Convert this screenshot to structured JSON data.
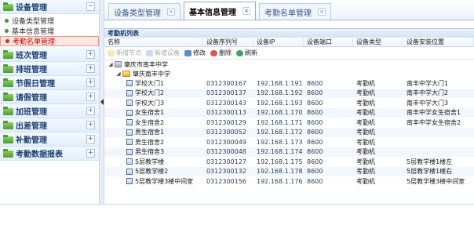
{
  "sidebar": {
    "menus": [
      {
        "title": "设备管理",
        "toggle": "−",
        "items": [
          {
            "label": "设备类型管理",
            "active": false
          },
          {
            "label": "基本信息管理",
            "active": false
          },
          {
            "label": "考勤名单管理",
            "active": true
          }
        ]
      },
      {
        "title": "班次管理",
        "toggle": "+"
      },
      {
        "title": "排班管理",
        "toggle": "+"
      },
      {
        "title": "节假日管理",
        "toggle": "+"
      },
      {
        "title": "请假管理",
        "toggle": "+"
      },
      {
        "title": "加班管理",
        "toggle": "+"
      },
      {
        "title": "出差管理",
        "toggle": "+"
      },
      {
        "title": "补勤管理",
        "toggle": "+"
      },
      {
        "title": "考勤数据报表",
        "toggle": "+"
      }
    ]
  },
  "tabs": [
    {
      "label": "设备类型管理",
      "close": "×",
      "active": false
    },
    {
      "label": "基本信息管理",
      "close": "×",
      "active": true
    },
    {
      "label": "考勤名单管理",
      "close": "×",
      "active": false
    }
  ],
  "panel": {
    "title": "考勤机列表",
    "columns": [
      "名称",
      "设备序列号",
      "设备IP",
      "设备端口",
      "设备类型",
      "设备安装位置"
    ]
  },
  "toolbar": {
    "add_label": "新增节点",
    "new_label": "新增设备",
    "edit_label": "修改",
    "delete_label": "删除",
    "refresh_label": "刷新"
  },
  "tree": {
    "root_label": "肇庆市南丰中学",
    "child_label": "肇庆南丰中学"
  },
  "rows": [
    {
      "name": "学校大门1",
      "serial": "0312300167",
      "ip": "192.168.1.191",
      "port": "8600",
      "type": "考勤机",
      "location": "南丰中学大门1"
    },
    {
      "name": "学校大门2",
      "serial": "0312300137",
      "ip": "192.168.1.192",
      "port": "8600",
      "type": "考勤机",
      "location": "南丰中学大门2"
    },
    {
      "name": "学校大门3",
      "serial": "0312300143",
      "ip": "192.168.1.193",
      "port": "8600",
      "type": "考勤机",
      "location": "南丰中学大门3"
    },
    {
      "name": "女生宿舍1",
      "serial": "0312300113",
      "ip": "192.168.1.170",
      "port": "8600",
      "type": "考勤机",
      "location": "南丰中学女生宿舍1"
    },
    {
      "name": "女生宿舍2",
      "serial": "0312300129",
      "ip": "192.168.1.171",
      "port": "8600",
      "type": "考勤机",
      "location": "南丰中学女生宿舍2"
    },
    {
      "name": "男生宿舍1",
      "serial": "0312300052",
      "ip": "192.168.1.172",
      "port": "8600",
      "type": "考勤机",
      "location": ""
    },
    {
      "name": "男生宿舍2",
      "serial": "0312300049",
      "ip": "192.168.1.173",
      "port": "8600",
      "type": "考勤机",
      "location": ""
    },
    {
      "name": "男生宿舍3",
      "serial": "0312300048",
      "ip": "192.168.1.174",
      "port": "8600",
      "type": "考勤机",
      "location": ""
    },
    {
      "name": "5层教学楼",
      "serial": "0312300127",
      "ip": "192.168.1.175",
      "port": "8600",
      "type": "考勤机",
      "location": "5层教学楼1楼左"
    },
    {
      "name": "5层教学楼2",
      "serial": "0312300132",
      "ip": "192.168.1.178",
      "port": "8600",
      "type": "考勤机",
      "location": "5层教学楼1楼右"
    },
    {
      "name": "5层教学楼3楼中间室",
      "serial": "0312300156",
      "ip": "192.168.1.176",
      "port": "8600",
      "type": "考勤机",
      "location": "5层教学楼3楼中间室"
    }
  ]
}
